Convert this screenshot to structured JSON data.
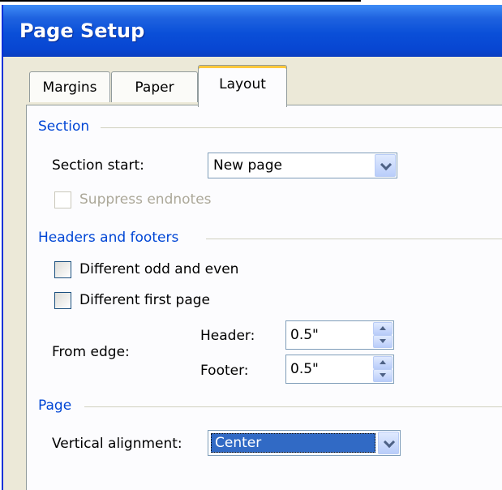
{
  "window": {
    "title": "Page Setup"
  },
  "tabs": [
    {
      "label": "Margins",
      "active": false
    },
    {
      "label": "Paper",
      "active": false
    },
    {
      "label": "Layout",
      "active": true
    }
  ],
  "section": {
    "group_title": "Section",
    "section_start_label": "Section start:",
    "section_start_value": "New page",
    "suppress_endnotes_label": "Suppress endnotes",
    "suppress_endnotes_checked": false,
    "suppress_endnotes_enabled": false
  },
  "headers_footers": {
    "group_title": "Headers and footers",
    "different_odd_even_label": "Different odd and even",
    "different_odd_even_checked": false,
    "different_first_page_label": "Different first page",
    "different_first_page_checked": false,
    "from_edge_label": "From edge:",
    "header_label": "Header:",
    "header_value": "0.5\"",
    "footer_label": "Footer:",
    "footer_value": "0.5\""
  },
  "page": {
    "group_title": "Page",
    "vertical_alignment_label": "Vertical alignment:",
    "vertical_alignment_value": "Center"
  },
  "colors": {
    "titlebar": "#0a4fd8",
    "group_title": "#0046d5",
    "selection": "#316ac5",
    "active_tab_accent": "#ffc83c"
  }
}
